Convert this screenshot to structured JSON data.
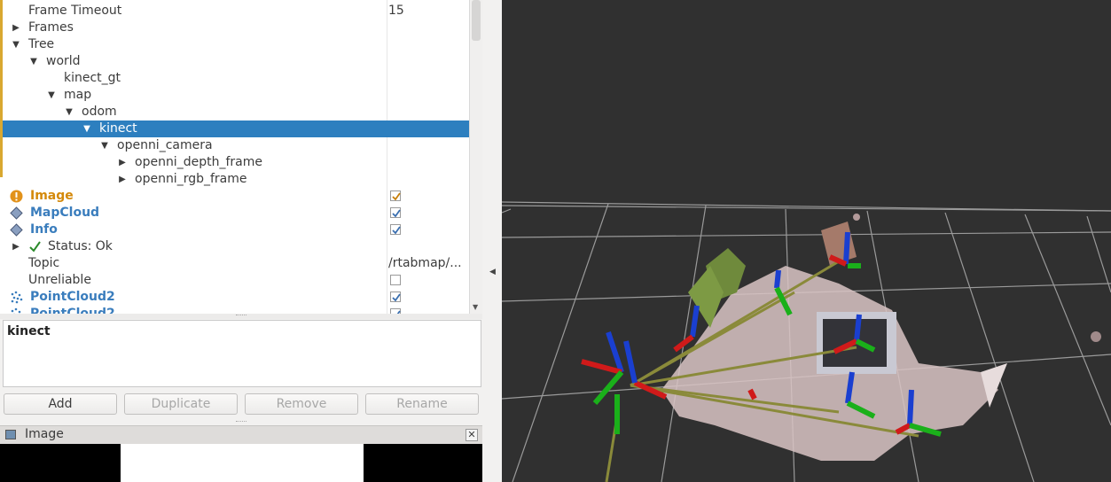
{
  "tree": {
    "rows": [
      {
        "label": "Frame Timeout",
        "value": "15"
      },
      {
        "label": "Frames"
      },
      {
        "label": "Tree"
      },
      {
        "label": "world"
      },
      {
        "label": "kinect_gt"
      },
      {
        "label": "map"
      },
      {
        "label": "odom"
      },
      {
        "label": "kinect"
      },
      {
        "label": "openni_camera"
      },
      {
        "label": "openni_depth_frame"
      },
      {
        "label": "openni_rgb_frame"
      },
      {
        "label": "Image",
        "checked": true
      },
      {
        "label": "MapCloud",
        "checked": true
      },
      {
        "label": "Info",
        "checked": true
      },
      {
        "label": "Status: Ok"
      },
      {
        "label": "Topic",
        "value": "/rtabmap/..."
      },
      {
        "label": "Unreliable",
        "checked": false
      },
      {
        "label": "PointCloud2",
        "checked": true
      },
      {
        "label": "PointCloud2",
        "checked": true
      }
    ]
  },
  "description": {
    "text": "kinect"
  },
  "buttons": {
    "add": "Add",
    "duplicate": "Duplicate",
    "remove": "Remove",
    "rename": "Rename"
  },
  "image_panel": {
    "title": "Image"
  },
  "colors": {
    "selection": "#2d7fbf",
    "display_name": "#3a7dbd",
    "warning": "#d4890a",
    "ok": "#2a8a2a"
  }
}
